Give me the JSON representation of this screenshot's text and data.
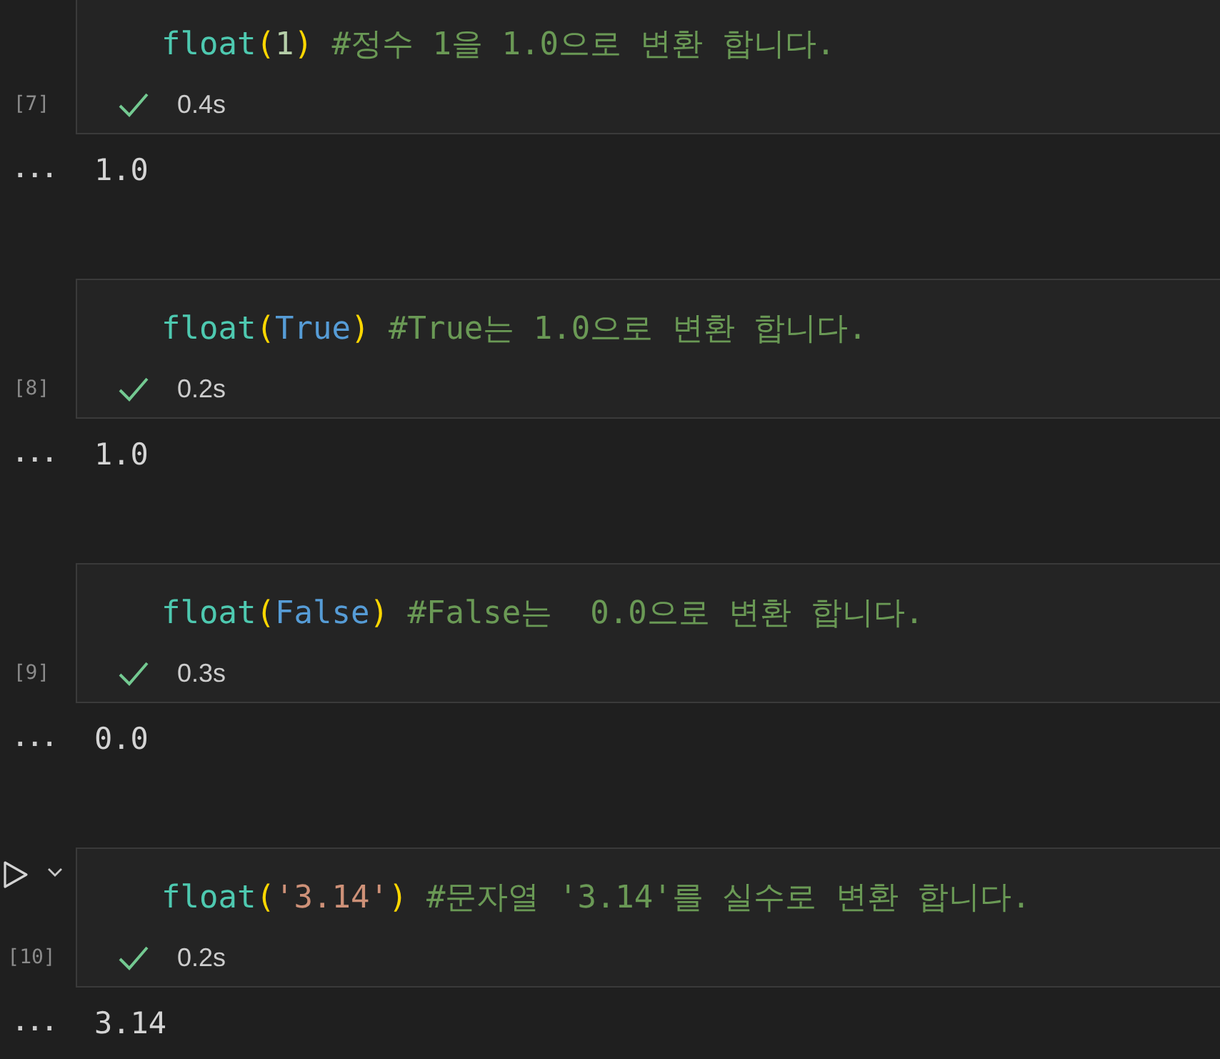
{
  "cells": [
    {
      "execution_count": "[7]",
      "hovered": false,
      "code": [
        {
          "kind": "function",
          "text": "float"
        },
        {
          "kind": "bracket",
          "text": "("
        },
        {
          "kind": "number",
          "text": "1"
        },
        {
          "kind": "bracket",
          "text": ")"
        },
        {
          "kind": "comment",
          "text": "#정수 1을 1.0으로 변환 합니다."
        }
      ],
      "succeeded": true,
      "duration": "0.4s",
      "output_prompt": "...",
      "output": "1.0"
    },
    {
      "execution_count": "[8]",
      "hovered": false,
      "code": [
        {
          "kind": "function",
          "text": "float"
        },
        {
          "kind": "bracket",
          "text": "("
        },
        {
          "kind": "constant",
          "text": "True"
        },
        {
          "kind": "bracket",
          "text": ")"
        },
        {
          "kind": "comment",
          "text": "#True는 1.0으로 변환 합니다."
        }
      ],
      "succeeded": true,
      "duration": "0.2s",
      "output_prompt": "...",
      "output": "1.0"
    },
    {
      "execution_count": "[9]",
      "hovered": false,
      "code": [
        {
          "kind": "function",
          "text": "float"
        },
        {
          "kind": "bracket",
          "text": "("
        },
        {
          "kind": "constant",
          "text": "False"
        },
        {
          "kind": "bracket",
          "text": ")"
        },
        {
          "kind": "comment",
          "text": "#False는  0.0으로 변환 합니다."
        }
      ],
      "succeeded": true,
      "duration": "0.3s",
      "output_prompt": "...",
      "output": "0.0"
    },
    {
      "execution_count": "[10]",
      "hovered": true,
      "code": [
        {
          "kind": "function",
          "text": "float"
        },
        {
          "kind": "bracket",
          "text": "("
        },
        {
          "kind": "string",
          "text": "'3.14'"
        },
        {
          "kind": "bracket",
          "text": ")"
        },
        {
          "kind": "comment",
          "text": "#문자열 '3.14'를 실수로 변환 합니다."
        }
      ],
      "succeeded": true,
      "duration": "0.2s",
      "output_prompt": "...",
      "output": "3.14"
    }
  ]
}
